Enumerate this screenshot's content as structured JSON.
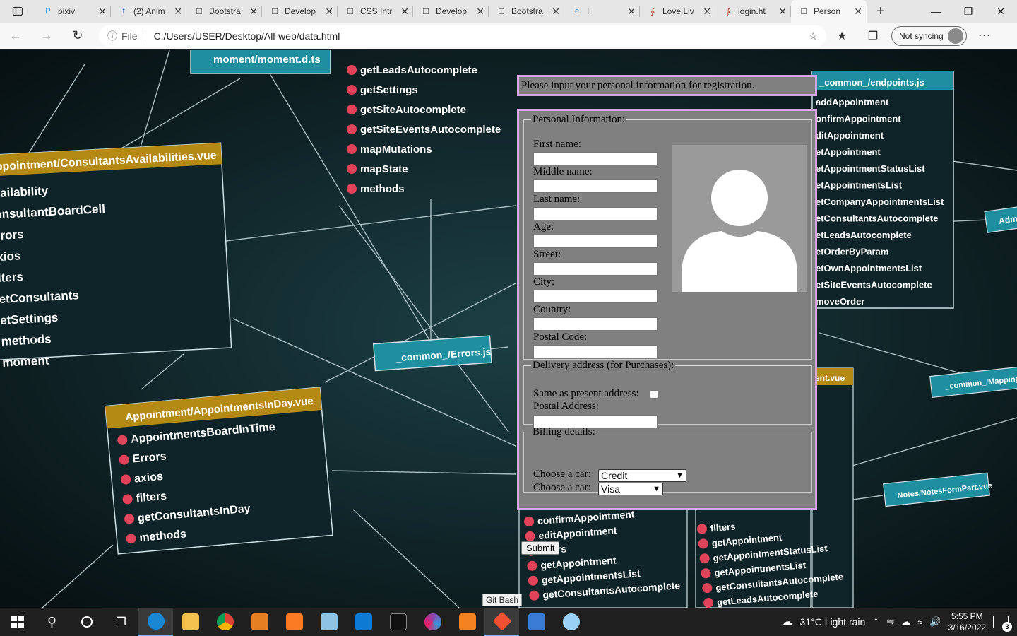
{
  "browser": {
    "tabs": [
      {
        "label": "pixiv",
        "icon": "pixiv-icon"
      },
      {
        "label": "(2) Anim",
        "icon": "facebook-icon"
      },
      {
        "label": "Bootstra",
        "icon": "page-icon"
      },
      {
        "label": "Develop",
        "icon": "page-icon"
      },
      {
        "label": "CSS Intr",
        "icon": "page-icon"
      },
      {
        "label": "Develop",
        "icon": "page-icon"
      },
      {
        "label": "Bootstra",
        "icon": "page-icon"
      },
      {
        "label": "I",
        "icon": "edge-icon"
      },
      {
        "label": "Love Liv",
        "icon": "pdf-icon"
      },
      {
        "label": "login.ht",
        "icon": "pdf-icon"
      },
      {
        "label": "Person",
        "icon": "page-icon",
        "active": true
      }
    ],
    "address": {
      "scheme_label": "File",
      "url": "C:/Users/USER/Desktop/All-web/data.html"
    },
    "profile": {
      "sync_label": "Not syncing"
    }
  },
  "page": {
    "intro_text": "Please input your personal information for registration.",
    "personal": {
      "legend": "Personal Information:",
      "fields": [
        {
          "label": "First name:",
          "value": ""
        },
        {
          "label": "Middle name:",
          "value": ""
        },
        {
          "label": "Last name:",
          "value": ""
        },
        {
          "label": "Age:",
          "value": ""
        },
        {
          "label": "Street:",
          "value": ""
        },
        {
          "label": "City:",
          "value": ""
        },
        {
          "label": "Country:",
          "value": ""
        },
        {
          "label": "Postal Code:",
          "value": ""
        }
      ]
    },
    "delivery": {
      "legend": "Delivery address (for Purchases):",
      "same_label": "Same as present address:",
      "same_checked": false,
      "postal_label": "Postal Address:",
      "postal_value": ""
    },
    "billing": {
      "legend": "Billing details:",
      "payment_label": "Choose a car:",
      "payment_value": "Credit",
      "card_label": "Choose a car:",
      "card_value": "Visa"
    },
    "submit_label": "Submit"
  },
  "background_labels": {
    "moment_file": "moment/moment.d.ts",
    "consultants_vue": "ppointment/ConsultantsAvailabilities.vue",
    "errors_js": "_common_/Errors.js",
    "appointments_vue": "Appointment/AppointmentsInDay.vue",
    "endpoints_js": "_common_/endpoints.js",
    "mapping_js": "_common_/MappingA",
    "notes_vue": "Notes/NotesFormPart.vue",
    "ent_vue": "ent.vue",
    "adm": "Adm",
    "top_list": [
      "getLeadsAutocomplete",
      "getSettings",
      "getSiteAutocomplete",
      "getSiteEventsAutocomplete",
      "mapMutations",
      "mapState",
      "methods"
    ],
    "left_list": [
      "vailability",
      "onsultantBoardCell",
      "rrors",
      "xios",
      "lters",
      "etConsultants",
      "etSettings",
      "methods",
      "moment"
    ],
    "bottom_left_list": [
      "AppointmentsBoardInTime",
      "Errors",
      "axios",
      "filters",
      "getConsultantsInDay",
      "methods"
    ],
    "right_list": [
      "addAppointment",
      "onfirmAppointment",
      "ditAppointment",
      "etAppointment",
      "etAppointmentStatusList",
      "etAppointmentsList",
      "etCompanyAppointmentsList",
      "etConsultantsAutocomplete",
      "etLeadsAutocomplete",
      "etOrderByParam",
      "etOwnAppointmentsList",
      "etSiteEventsAutocomplete",
      "moveOrder"
    ],
    "bottom_mid_list": [
      "confirmAppointment",
      "editAppointment",
      "filters",
      "getAppointment",
      "getAppointmentsList",
      "getConsultantsAutocomplete"
    ],
    "bottom_right_list": [
      "filters",
      "getAppointment",
      "getAppointmentStatusList",
      "getAppointmentsList",
      "getConsultantsAutocomplete",
      "getLeadsAutocomplete"
    ]
  },
  "tooltip": "Git Bash",
  "taskbar": {
    "weather": "31°C  Light rain",
    "time": "5:55 PM",
    "date": "3/16/2022",
    "notifications": "3"
  },
  "colors": {
    "form_bg": "#808080",
    "form_border": "#d6a4e4",
    "tab_strip": "#e6e6e6",
    "taskbar": "#202020"
  }
}
